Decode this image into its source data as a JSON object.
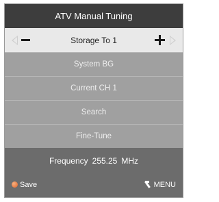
{
  "title": "ATV Manual Tuning",
  "storage": {
    "label": "Storage To 1"
  },
  "menu_items": [
    {
      "label": "System BG"
    },
    {
      "label": "Current CH 1"
    },
    {
      "label": "Search"
    },
    {
      "label": "Fine-Tune"
    }
  ],
  "frequency": {
    "label": "Frequency",
    "value": "255.25",
    "unit": "MHz"
  },
  "footer": {
    "save_label": "Save",
    "menu_label": "MENU"
  },
  "colors": {
    "title_bg": "#3d3d3d",
    "storage_bg": "#e9e9e9",
    "item_bg": "#a0a0a0",
    "panel_bg": "#6c6c6c",
    "save_dot": "#e0642a"
  }
}
